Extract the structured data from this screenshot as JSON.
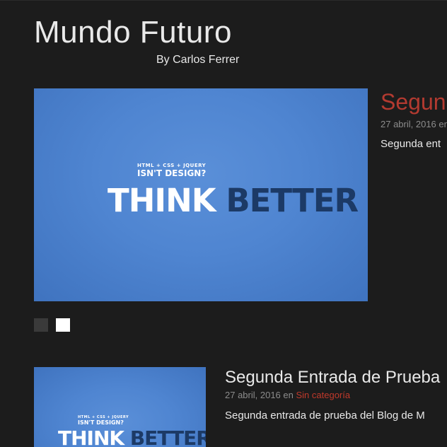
{
  "site": {
    "title": "Mundo Futuro",
    "tagline": "By Carlos Ferrer"
  },
  "slider": {
    "image": {
      "line1": "HTML + CSS + JQUERY",
      "line2": "ISN'T DESIGN?",
      "word1": "THINK",
      "word2": "BETTER"
    },
    "slide": {
      "title": "Segun",
      "meta": "27 abril, 2016 en",
      "excerpt": "Segunda ent"
    },
    "dots": [
      "1",
      "2"
    ],
    "active_dot": 2
  },
  "post": {
    "image": {
      "line1": "HTML + CSS + JQUERY",
      "line2": "ISN'T DESIGN?",
      "word1": "THINK",
      "word2": "BETTER"
    },
    "title": "Segunda Entrada de Prueba",
    "date": "27 abril, 2016",
    "meta_sep": "en",
    "category": "Sin categoría",
    "excerpt": "Segunda entrada de prueba del Blog de M"
  },
  "colors": {
    "background": "#1c1c1c",
    "accent": "#b33a30",
    "image_blue": "#4f85d1"
  }
}
